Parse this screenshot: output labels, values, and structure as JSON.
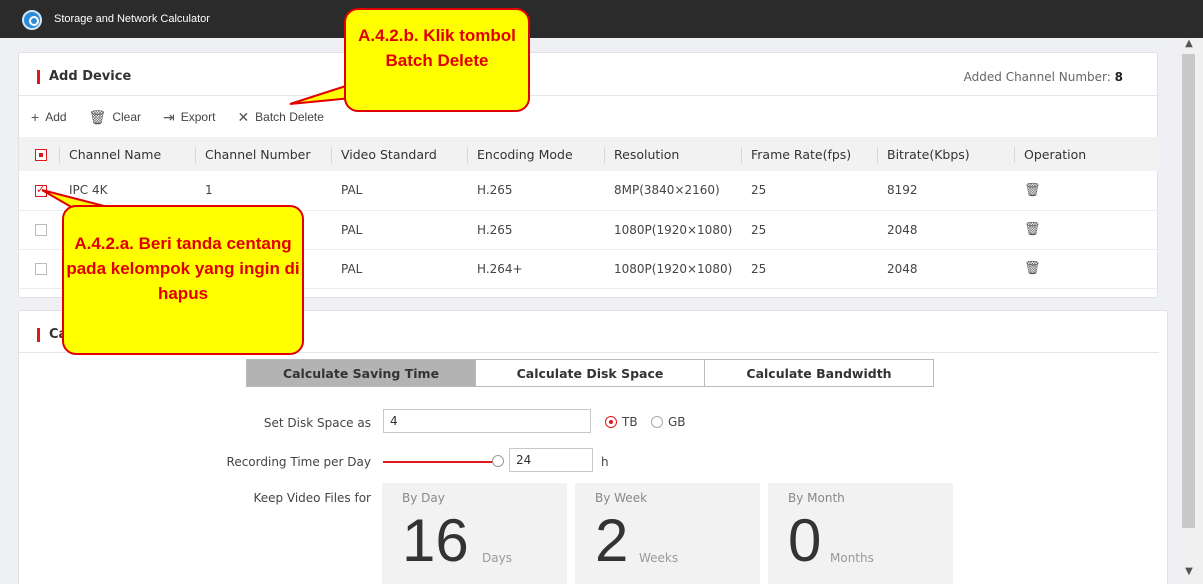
{
  "window": {
    "title": "Storage and Network Calculator"
  },
  "add_device": {
    "title": "Add Device",
    "added_label": "Added Channel Number:",
    "added_count": "8",
    "toolbar": {
      "add": "Add",
      "clear": "Clear",
      "export": "Export",
      "batch_delete": "Batch Delete"
    },
    "columns": [
      "Channel Name",
      "Channel Number",
      "Video Standard",
      "Encoding Mode",
      "Resolution",
      "Frame Rate(fps)",
      "Bitrate(Kbps)",
      "Operation"
    ],
    "rows": [
      {
        "checked": true,
        "name": "IPC 4K",
        "number": "1",
        "standard": "PAL",
        "encoding": "H.265",
        "resolution": "8MP(3840×2160)",
        "fps": "25",
        "bitrate": "8192"
      },
      {
        "checked": false,
        "name": "",
        "number": "",
        "standard": "PAL",
        "encoding": "H.265",
        "resolution": "1080P(1920×1080)",
        "fps": "25",
        "bitrate": "2048"
      },
      {
        "checked": false,
        "name": "",
        "number": "",
        "standard": "PAL",
        "encoding": "H.264+",
        "resolution": "1080P(1920×1080)",
        "fps": "25",
        "bitrate": "2048"
      }
    ]
  },
  "calculator": {
    "title_visible": "Ca",
    "tabs": [
      "Calculate Saving Time",
      "Calculate Disk Space",
      "Calculate Bandwidth"
    ],
    "disk_label": "Set Disk Space as",
    "disk_value": "4",
    "unit_tb": "TB",
    "unit_gb": "GB",
    "rec_label": "Recording Time per Day",
    "rec_value": "24",
    "rec_unit": "h",
    "keep_label": "Keep Video Files for",
    "cards": [
      {
        "label": "By Day",
        "value": "16",
        "unit": "Days"
      },
      {
        "label": "By Week",
        "value": "2",
        "unit": "Weeks"
      },
      {
        "label": "By Month",
        "value": "0",
        "unit": "Months"
      }
    ]
  },
  "annotations": {
    "callout_b": "A.4.2.b. Klik tombol Batch Delete",
    "callout_a": "A.4.2.a. Beri tanda centang pada kelompok yang ingin di hapus"
  },
  "colors": {
    "accent": "#e0181c",
    "callout_fill": "#ffff00",
    "titlebar": "#2b2b2b"
  }
}
